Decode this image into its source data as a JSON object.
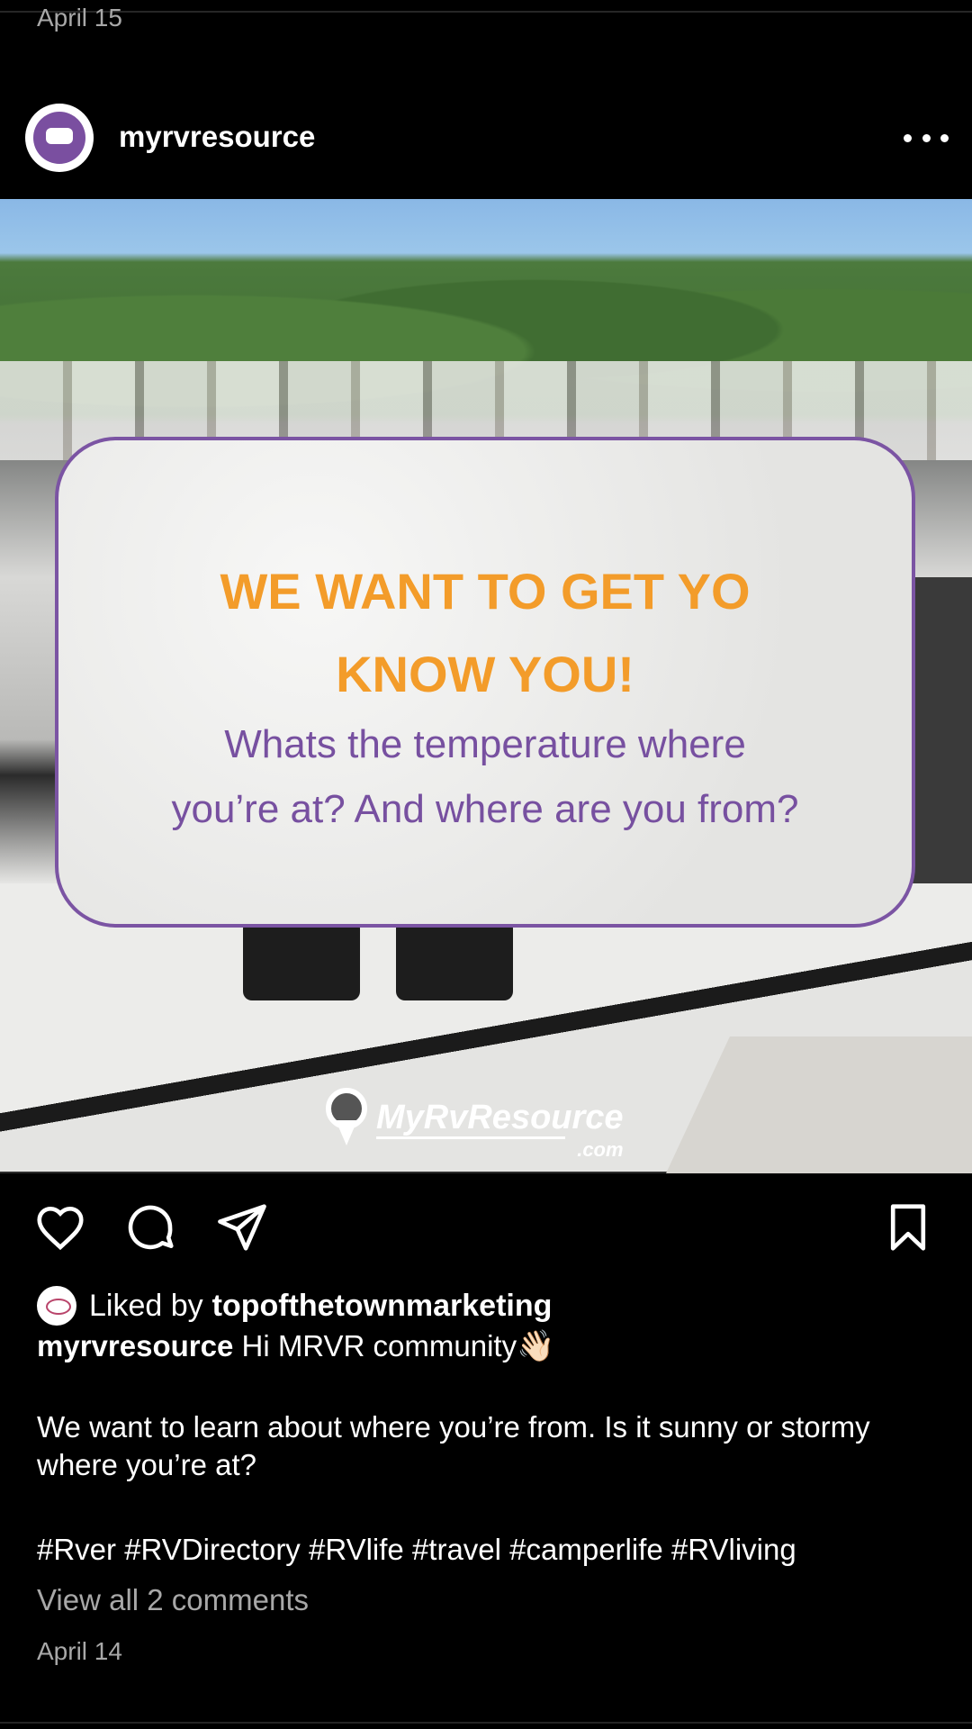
{
  "top_date": "April 15",
  "post": {
    "username": "myrvresource",
    "avatar_label": "MyRvResource",
    "card_headline": "WE WANT TO GET YO\nKNOW YOU!",
    "card_subtext": "Whats the temperature where\nyou’re at? And where are you from?",
    "brand_name": "MyRvResource",
    "brand_domain": ".com",
    "liked_prefix": "Liked by",
    "liked_by": "topofthetownmarketing",
    "caption_username": "myrvresource",
    "caption_first": "Hi MRVR community",
    "caption_emoji": "👋🏻",
    "caption_body": "We want to learn about where you’re from. Is it sunny or stormy where you’re at?",
    "hashtags": "#Rver #RVDirectory #RVlife #travel #camperlife #RVliving",
    "view_comments": "View all 2 comments",
    "date": "April 14"
  },
  "icons": {
    "like": "heart-icon",
    "comment": "comment-icon",
    "share": "send-icon",
    "save": "bookmark-icon",
    "more": "more-horizontal-icon"
  },
  "colors": {
    "background": "#000000",
    "headline": "#f39c2a",
    "subtext": "#7750a0",
    "card_border": "#7b54a3",
    "muted_text": "#a8a8a8"
  }
}
